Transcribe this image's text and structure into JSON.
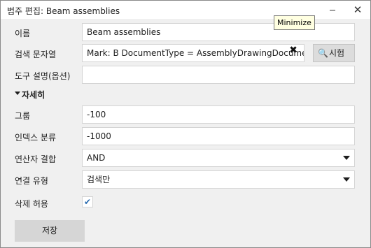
{
  "window": {
    "title": "범주 편집: Beam assemblies",
    "close_glyph": "✕",
    "tooltip": "Minimize"
  },
  "form": {
    "name_label": "이름",
    "name_value": "Beam assemblies",
    "search_label": "검색 문자열",
    "search_value": "Mark: B DocumentType = AssemblyDrawingDocument",
    "clear_glyph": "✖",
    "test_icon": "🔍",
    "test_label": "시험",
    "tooltip_label": "도구 설명(옵션)",
    "tooltip_value": "",
    "details_label": "자세히",
    "group_label": "그룹",
    "group_value": "-100",
    "index_label": "인덱스 분류",
    "index_value": "-1000",
    "operator_label": "연산자 결합",
    "operator_value": "AND",
    "link_label": "연결 유형",
    "link_value": "검색만",
    "delete_label": "삭제 허용",
    "delete_checked": true,
    "check_glyph": "✔",
    "save_label": "저장"
  }
}
